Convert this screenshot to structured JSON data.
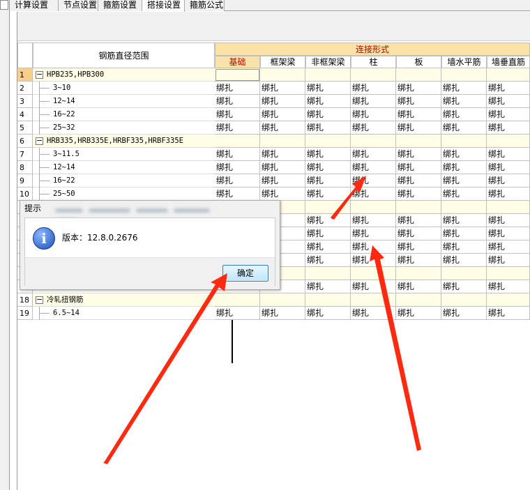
{
  "tabs": [
    {
      "label": "计算设置",
      "active": false
    },
    {
      "label": "节点设置",
      "active": false
    },
    {
      "label": "箍筋设置",
      "active": false
    },
    {
      "label": "搭接设置",
      "active": true
    },
    {
      "label": "箍筋公式",
      "active": false
    }
  ],
  "grid": {
    "header_diameter": "钢筋直径范围",
    "header_connection": "连接形式",
    "columns": [
      "基础",
      "框架梁",
      "非框架梁",
      "柱",
      "板",
      "墙水平筋",
      "墙垂直筋"
    ],
    "rows": [
      {
        "num": "1",
        "label": "HPB235,HPB300",
        "group": true,
        "cells": [
          "",
          "",
          "",
          "",
          "",
          "",
          ""
        ]
      },
      {
        "num": "2",
        "label": "3~10",
        "group": false,
        "cells": [
          "绑扎",
          "绑扎",
          "绑扎",
          "绑扎",
          "绑扎",
          "绑扎",
          "绑扎"
        ]
      },
      {
        "num": "3",
        "label": "12~14",
        "group": false,
        "cells": [
          "绑扎",
          "绑扎",
          "绑扎",
          "绑扎",
          "绑扎",
          "绑扎",
          "绑扎"
        ]
      },
      {
        "num": "4",
        "label": "16~22",
        "group": false,
        "cells": [
          "绑扎",
          "绑扎",
          "绑扎",
          "绑扎",
          "绑扎",
          "绑扎",
          "绑扎"
        ]
      },
      {
        "num": "5",
        "label": "25~32",
        "group": false,
        "cells": [
          "绑扎",
          "绑扎",
          "绑扎",
          "绑扎",
          "绑扎",
          "绑扎",
          "绑扎"
        ]
      },
      {
        "num": "6",
        "label": "HRB335,HRB335E,HRBF335,HRBF335E",
        "group": true,
        "cells": [
          "",
          "",
          "",
          "",
          "",
          "",
          ""
        ]
      },
      {
        "num": "7",
        "label": "3~11.5",
        "group": false,
        "cells": [
          "绑扎",
          "绑扎",
          "绑扎",
          "绑扎",
          "绑扎",
          "绑扎",
          "绑扎"
        ]
      },
      {
        "num": "8",
        "label": "12~14",
        "group": false,
        "cells": [
          "绑扎",
          "绑扎",
          "绑扎",
          "绑扎",
          "绑扎",
          "绑扎",
          "绑扎"
        ]
      },
      {
        "num": "9",
        "label": "16~22",
        "group": false,
        "cells": [
          "绑扎",
          "绑扎",
          "绑扎",
          "绑扎",
          "绑扎",
          "绑扎",
          "绑扎"
        ]
      },
      {
        "num": "10",
        "label": "25~50",
        "group": false,
        "cells": [
          "绑扎",
          "绑扎",
          "绑扎",
          "绑扎",
          "绑扎",
          "绑扎",
          "绑扎"
        ]
      },
      {
        "num": "",
        "label": "",
        "group": true,
        "cells": [
          "",
          "",
          "",
          "",
          "",
          "",
          ""
        ]
      },
      {
        "num": "",
        "label": "",
        "group": false,
        "cells": [
          "",
          "",
          "绑扎",
          "绑扎",
          "绑扎",
          "绑扎",
          "绑扎"
        ]
      },
      {
        "num": "",
        "label": "",
        "group": false,
        "cells": [
          "",
          "",
          "绑扎",
          "绑扎",
          "绑扎",
          "绑扎",
          "绑扎"
        ]
      },
      {
        "num": "",
        "label": "",
        "group": false,
        "cells": [
          "",
          "",
          "绑扎",
          "绑扎",
          "绑扎",
          "绑扎",
          "绑扎"
        ]
      },
      {
        "num": "",
        "label": "",
        "group": false,
        "cells": [
          "",
          "",
          "绑扎",
          "绑扎",
          "绑扎",
          "绑扎",
          "绑扎"
        ]
      },
      {
        "num": "",
        "label": "",
        "group": true,
        "cells": [
          "",
          "",
          "",
          "",
          "",
          "",
          ""
        ]
      },
      {
        "num": "",
        "label": "",
        "group": false,
        "cells": [
          "",
          "",
          "绑扎",
          "绑扎",
          "绑扎",
          "绑扎",
          "绑扎"
        ]
      },
      {
        "num": "18",
        "label": "冷轧扭钢筋",
        "group": true,
        "cells": [
          "",
          "",
          "",
          "",
          "",
          "",
          ""
        ]
      },
      {
        "num": "19",
        "label": "6.5~14",
        "group": false,
        "cells": [
          "绑扎",
          "绑扎",
          "绑扎",
          "绑扎",
          "绑扎",
          "绑扎",
          "绑扎"
        ]
      }
    ]
  },
  "dialog": {
    "title": "提示",
    "message": "版本：12.8.0.2676",
    "ok_label": "确定"
  },
  "colors": {
    "accent_header": "#fbe3a7",
    "header_text": "#c00000",
    "group_row": "#fffde6",
    "arrow": "#ff2a10"
  }
}
